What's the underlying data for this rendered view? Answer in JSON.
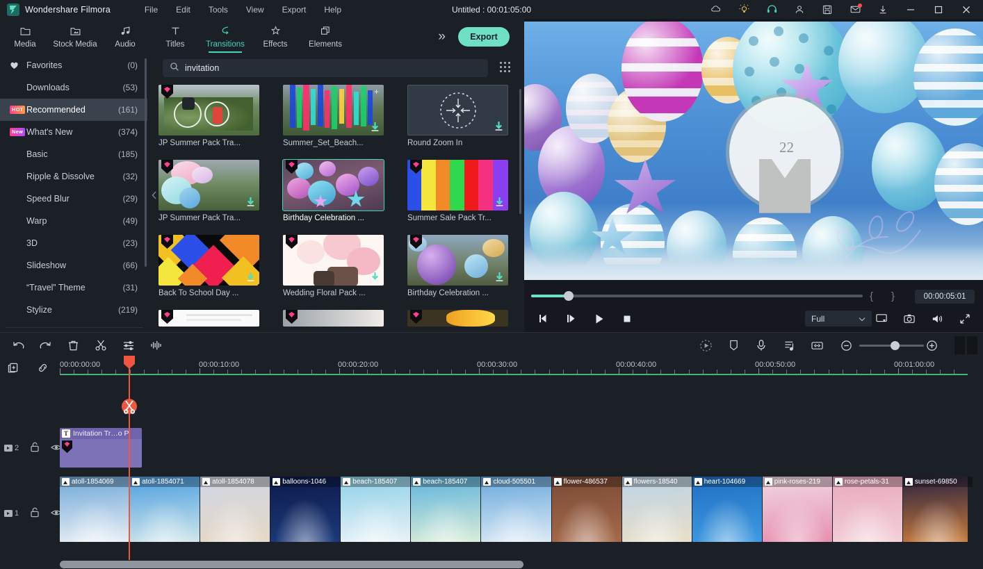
{
  "app": {
    "name": "Wondershare Filmora",
    "title": "Untitled : 00:01:05:00"
  },
  "menu": [
    {
      "label": "File"
    },
    {
      "label": "Edit"
    },
    {
      "label": "Tools"
    },
    {
      "label": "View"
    },
    {
      "label": "Export"
    },
    {
      "label": "Help"
    }
  ],
  "title_icons": [
    {
      "name": "cloud-icon"
    },
    {
      "name": "lightbulb-icon"
    },
    {
      "name": "headset-icon"
    },
    {
      "name": "account-icon"
    },
    {
      "name": "save-icon"
    },
    {
      "name": "mail-icon"
    },
    {
      "name": "download-icon"
    },
    {
      "name": "minimize-icon"
    },
    {
      "name": "maximize-icon"
    },
    {
      "name": "close-icon"
    }
  ],
  "tabs": [
    {
      "label": "Media",
      "icon": "media-icon",
      "active": false
    },
    {
      "label": "Stock Media",
      "icon": "stock-media-icon",
      "active": false
    },
    {
      "label": "Audio",
      "icon": "audio-icon",
      "active": false
    },
    {
      "label": "Titles",
      "icon": "titles-icon",
      "active": false
    },
    {
      "label": "Transitions",
      "icon": "transitions-icon",
      "active": true
    },
    {
      "label": "Effects",
      "icon": "effects-icon",
      "active": false
    },
    {
      "label": "Elements",
      "icon": "elements-icon",
      "active": false
    }
  ],
  "toolbar": {
    "more_label": "»",
    "export_label": "Export"
  },
  "sidebar": {
    "items": [
      {
        "label": "Favorites",
        "count": "(0)",
        "tag": "heart",
        "active": false
      },
      {
        "label": "Downloads",
        "count": "(53)",
        "tag": "",
        "active": false
      },
      {
        "label": "Recommended",
        "count": "(161)",
        "tag": "HOT",
        "active": true
      },
      {
        "label": "What's New",
        "count": "(374)",
        "tag": "New",
        "active": false
      },
      {
        "label": "Basic",
        "count": "(185)",
        "tag": "",
        "active": false
      },
      {
        "label": "Ripple & Dissolve",
        "count": "(32)",
        "tag": "",
        "active": false
      },
      {
        "label": "Speed Blur",
        "count": "(29)",
        "tag": "",
        "active": false
      },
      {
        "label": "Warp",
        "count": "(49)",
        "tag": "",
        "active": false
      },
      {
        "label": "3D",
        "count": "(23)",
        "tag": "",
        "active": false
      },
      {
        "label": "Slideshow",
        "count": "(66)",
        "tag": "",
        "active": false
      },
      {
        "label": "“Travel” Theme",
        "count": "(31)",
        "tag": "",
        "active": false
      },
      {
        "label": "Stylize",
        "count": "(219)",
        "tag": "",
        "active": false
      }
    ]
  },
  "search": {
    "value": "invitation",
    "placeholder": "Search",
    "icon": "search-icon"
  },
  "transitions": [
    {
      "label": "JP Summer Pack Tra...",
      "premium": true,
      "download": false,
      "selected": false,
      "plus": false,
      "kind": "photo-forest"
    },
    {
      "label": "Summer_Set_Beach...",
      "premium": false,
      "download": true,
      "selected": false,
      "plus": true,
      "kind": "glitch-bars"
    },
    {
      "label": "Round Zoom In",
      "premium": false,
      "download": true,
      "selected": false,
      "plus": false,
      "kind": "zoom-diagram"
    },
    {
      "label": "JP Summer Pack Tra...",
      "premium": true,
      "download": true,
      "selected": false,
      "plus": false,
      "kind": "pastel-balloons"
    },
    {
      "label": "Birthday Celebration ...",
      "premium": true,
      "download": false,
      "selected": true,
      "plus": false,
      "kind": "balloon-party"
    },
    {
      "label": "Summer Sale Pack Tr...",
      "premium": true,
      "download": true,
      "selected": false,
      "plus": false,
      "kind": "color-stripes"
    },
    {
      "label": "Back To School Day ...",
      "premium": true,
      "download": true,
      "selected": false,
      "plus": false,
      "kind": "mosaic"
    },
    {
      "label": "Wedding Floral Pack ...",
      "premium": true,
      "download": true,
      "selected": false,
      "plus": false,
      "kind": "floral-white"
    },
    {
      "label": "Birthday Celebration ...",
      "premium": true,
      "download": true,
      "selected": false,
      "plus": false,
      "kind": "purple-balloon"
    },
    {
      "label": "",
      "premium": true,
      "download": false,
      "selected": false,
      "plus": false,
      "kind": "white-doc"
    },
    {
      "label": "",
      "premium": true,
      "download": false,
      "selected": false,
      "plus": false,
      "kind": "grey-soft"
    },
    {
      "label": "",
      "premium": true,
      "download": false,
      "selected": false,
      "plus": false,
      "kind": "gold-burst"
    }
  ],
  "preview": {
    "watermark_number": "22",
    "current_time": "00:00:05:01",
    "mark_in": "{",
    "mark_out": "}",
    "quality": "Full",
    "controls": [
      {
        "name": "prev-frame-button",
        "glyph": "prev"
      },
      {
        "name": "next-frame-button",
        "glyph": "next"
      },
      {
        "name": "play-button",
        "glyph": "play"
      },
      {
        "name": "stop-button",
        "glyph": "stop"
      }
    ],
    "right_controls": [
      {
        "name": "display-settings-icon"
      },
      {
        "name": "snapshot-icon"
      },
      {
        "name": "volume-icon"
      },
      {
        "name": "fullscreen-icon"
      }
    ]
  },
  "timeline_toolbar": {
    "left_tools": [
      {
        "name": "undo-button",
        "icon": "undo-icon"
      },
      {
        "name": "redo-button",
        "icon": "redo-icon"
      },
      {
        "name": "delete-button",
        "icon": "trash-icon"
      },
      {
        "name": "split-button",
        "icon": "scissors-icon"
      },
      {
        "name": "adjust-button",
        "icon": "sliders-icon"
      },
      {
        "name": "audio-waveform-button",
        "icon": "waveform-icon"
      }
    ],
    "right_tools": [
      {
        "name": "render-preview-button",
        "icon": "render-icon"
      },
      {
        "name": "marker-button",
        "icon": "marker-icon"
      },
      {
        "name": "record-voiceover-button",
        "icon": "microphone-icon"
      },
      {
        "name": "audio-mixer-button",
        "icon": "mixer-icon"
      },
      {
        "name": "fit-timeline-button",
        "icon": "fit-icon"
      },
      {
        "name": "zoom-out-button",
        "icon": "zoom-out-icon"
      },
      {
        "name": "zoom-in-button",
        "icon": "zoom-in-icon"
      }
    ]
  },
  "ruler": {
    "labels": [
      "00:00:00:00",
      "00:00:10:00",
      "00:00:20:00",
      "00:00:30:00",
      "00:00:40:00",
      "00:00:50:00",
      "00:01:00:00"
    ]
  },
  "tracks": [
    {
      "name": "text-track",
      "number": "2",
      "lock_icon": "unlock-icon",
      "eye_icon": "eye-icon",
      "clips": [
        {
          "label": "Invitation Tr…o P",
          "type": "text",
          "premium": true
        }
      ]
    },
    {
      "name": "video-track",
      "number": "1",
      "lock_icon": "unlock-icon",
      "eye_icon": "eye-icon",
      "clips": [
        {
          "label": "atoll-1854069",
          "c1": "#6fa8d8",
          "c2": "#e8eef5"
        },
        {
          "label": "atoll-1854071",
          "c1": "#4d9fe0",
          "c2": "#cfe6ea"
        },
        {
          "label": "atoll-1854078",
          "c1": "#cfd6e3",
          "c2": "#e6d8c6"
        },
        {
          "label": "balloons-1046",
          "c1": "#0d1a4a",
          "c2": "#1b3a7a"
        },
        {
          "label": "beach-185407",
          "c1": "#8fd0e8",
          "c2": "#e9f3f7"
        },
        {
          "label": "beach-185407",
          "c1": "#5fb4dd",
          "c2": "#d8ecd8"
        },
        {
          "label": "cloud-505501",
          "c1": "#6aa9dc",
          "c2": "#dbe9f5"
        },
        {
          "label": "flower-486537",
          "c1": "#7a4a36",
          "c2": "#a56a4a"
        },
        {
          "label": "flowers-18540",
          "c1": "#bcd3e6",
          "c2": "#e8dfc8"
        },
        {
          "label": "heart-104669",
          "c1": "#1f6fc4",
          "c2": "#3f9ae0"
        },
        {
          "label": "pink-roses-219",
          "c1": "#f0d8e2",
          "c2": "#e78fb0"
        },
        {
          "label": "rose-petals-31",
          "c1": "#e9a8bc",
          "c2": "#f2d0da"
        },
        {
          "label": "sunset-69850",
          "c1": "#2a2340",
          "c2": "#c87a3a"
        }
      ]
    }
  ]
}
